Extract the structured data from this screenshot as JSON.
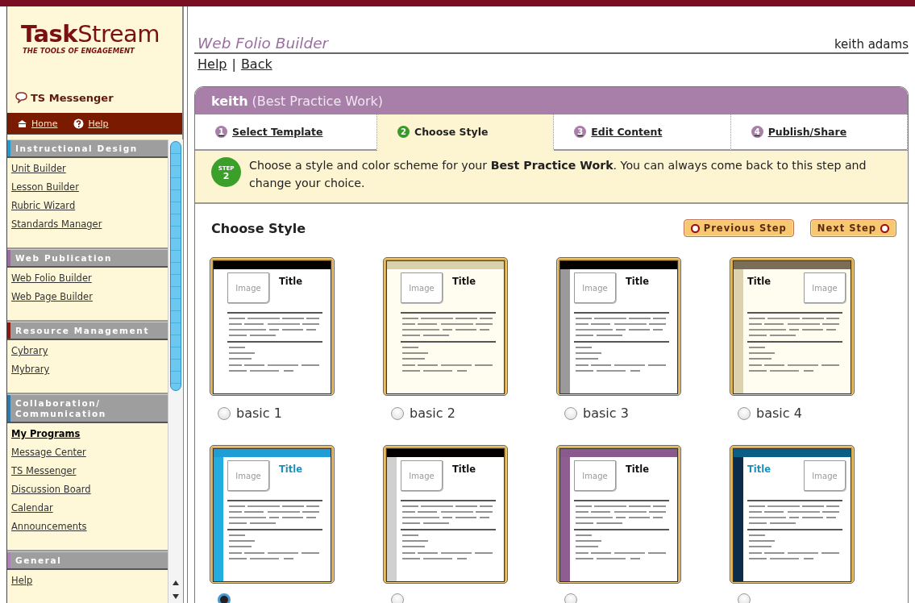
{
  "sidebar": {
    "logo": {
      "bold": "Task",
      "light": "Stream",
      "tagline": "THE TOOLS OF ENGAGEMENT"
    },
    "messenger": "TS Messenger",
    "nav": [
      {
        "label": "Home",
        "kind": "home"
      },
      {
        "label": "Help",
        "kind": "help"
      }
    ],
    "sections": [
      {
        "title": "Instructional Design",
        "color": "#1e9ad0",
        "links": [
          {
            "label": "Unit Builder",
            "selected": false
          },
          {
            "label": "Lesson Builder",
            "selected": false
          },
          {
            "label": "Rubric Wizard",
            "selected": false
          },
          {
            "label": "Standards Manager",
            "selected": false
          }
        ]
      },
      {
        "title": "Web Publication",
        "color": "#9a6aa0",
        "links": [
          {
            "label": "Web Folio Builder",
            "selected": false
          },
          {
            "label": "Web Page Builder",
            "selected": false
          }
        ]
      },
      {
        "title": "Resource Management",
        "color": "#8a1a10",
        "links": [
          {
            "label": "Cybrary",
            "selected": false
          },
          {
            "label": "Mybrary",
            "selected": false
          }
        ]
      },
      {
        "title": "Collaboration/ Communication",
        "color": "#2a7ab0",
        "links": [
          {
            "label": "My Programs",
            "selected": true
          },
          {
            "label": "Message Center",
            "selected": false
          },
          {
            "label": "TS Messenger",
            "selected": false
          },
          {
            "label": "Discussion Board",
            "selected": false
          },
          {
            "label": "Calendar",
            "selected": false
          },
          {
            "label": "Announcements",
            "selected": false
          }
        ]
      },
      {
        "title": "General",
        "color": "#b080b8",
        "links": [
          {
            "label": "Help",
            "selected": false
          }
        ]
      }
    ]
  },
  "header": {
    "title": "Web Folio Builder",
    "user": "keith adams",
    "links": [
      "Help",
      "Back"
    ],
    "separator": "|"
  },
  "panel": {
    "owner": "keith",
    "portfolio": "(Best Practice Work)",
    "tabs": [
      {
        "number": "1",
        "label": "Select Template",
        "selected": false
      },
      {
        "number": "2",
        "label": "Choose Style",
        "selected": true
      },
      {
        "number": "3",
        "label": "Edit Content",
        "selected": false
      },
      {
        "number": "4",
        "label": "Publish/Share",
        "selected": false
      }
    ],
    "step": {
      "word": "STEP",
      "number": "2",
      "text": "Choose a style and color scheme for your **Best Practice Work**. You can always come back to this step and change your choice."
    },
    "heading": "Choose Style",
    "buttons": [
      {
        "label": "Previous Step",
        "kind": "previous"
      },
      {
        "label": "Next Step",
        "kind": "next"
      }
    ],
    "styles": [
      {
        "label": "basic 1",
        "selected": false,
        "kind": "image-left",
        "header": {
          "color": "#050000"
        },
        "paper": {
          "color": "#ffffff"
        },
        "title": {
          "text": "Title",
          "color": "#111111"
        },
        "image": "Image"
      },
      {
        "label": "basic 2",
        "selected": false,
        "kind": "image-left",
        "header": {
          "color": "#d9d0ad"
        },
        "paper": {
          "color": "#fffcf0"
        },
        "title": {
          "text": "Title",
          "color": "#111111"
        },
        "image": "Image"
      },
      {
        "label": "basic 3",
        "selected": false,
        "kind": "image-left",
        "header": {
          "color": "#050000"
        },
        "stripe": {
          "color": "#9a9a9a"
        },
        "paper": {
          "color": "#ffffff"
        },
        "title": {
          "text": "Title",
          "color": "#111111"
        },
        "image": "Image"
      },
      {
        "label": "basic 4",
        "selected": false,
        "kind": "image-right",
        "header": {
          "color": "#7a6e58"
        },
        "stripe": {
          "color": "#dcd2ad"
        },
        "paper": {
          "color": "#fffcf0"
        },
        "title": {
          "text": "Title",
          "color": "#111111"
        },
        "image": "Image"
      },
      {
        "selected": true,
        "kind": "image-left",
        "header": {
          "color": "#1e9ed4"
        },
        "stripe": {
          "color": "#22acdf"
        },
        "paper": {
          "color": "#ffffff"
        },
        "title": {
          "text": "Title",
          "color": "#1a8fc0"
        },
        "image": "Image"
      },
      {
        "selected": false,
        "kind": "image-left",
        "header": {
          "color": "#050000"
        },
        "stripe": {
          "color": "#d0d0d0"
        },
        "paper": {
          "color": "#ffffff"
        },
        "title": {
          "text": "Title",
          "color": "#111111"
        },
        "image": "Image"
      },
      {
        "selected": false,
        "kind": "image-left",
        "header": {
          "color": "#8a5a8c"
        },
        "stripe": {
          "color": "#8e5e90"
        },
        "paper": {
          "color": "#ffffff"
        },
        "title": {
          "text": "Title",
          "color": "#111111"
        },
        "image": "Image"
      },
      {
        "selected": false,
        "kind": "image-right",
        "header": {
          "color": "#0b5e86"
        },
        "stripe": {
          "color": "#0b2c4a"
        },
        "paper": {
          "color": "#ffffff"
        },
        "title": {
          "text": "Title",
          "color": "#1a8fc0"
        },
        "image": "Image"
      }
    ]
  }
}
